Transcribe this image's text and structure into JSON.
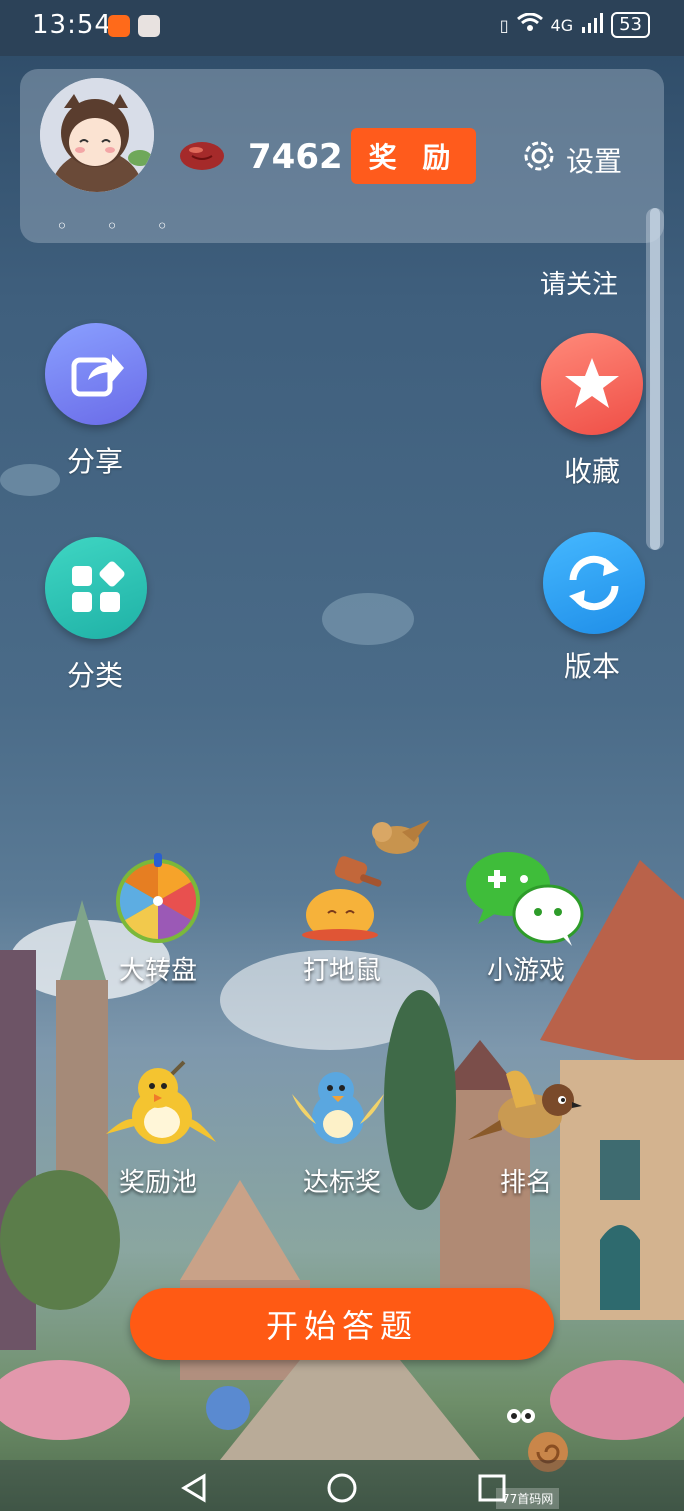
{
  "status": {
    "time": "13:54",
    "network": "4G",
    "battery": "53"
  },
  "profile": {
    "points": "7462",
    "reward_label": "奖 励",
    "settings_label": "设置",
    "dots": "◦ ◦ ◦"
  },
  "marquee": {
    "text": "请关注"
  },
  "actions": {
    "share": "分享",
    "favorite": "收藏",
    "category": "分类",
    "version": "版本"
  },
  "games": {
    "wheel": "大转盘",
    "whack": "打地鼠",
    "minigame": "小游戏",
    "prizepool": "奖励池",
    "target": "达标奖",
    "rank": "排名"
  },
  "start": {
    "label": "开始答题"
  },
  "watermark": "77首码网",
  "colors": {
    "accent": "#ff5a14",
    "share_blue": "#6c7ff0",
    "fav_red": "#f25b52",
    "cat_teal": "#2bc4b3",
    "ver_blue": "#2a9ff0"
  }
}
